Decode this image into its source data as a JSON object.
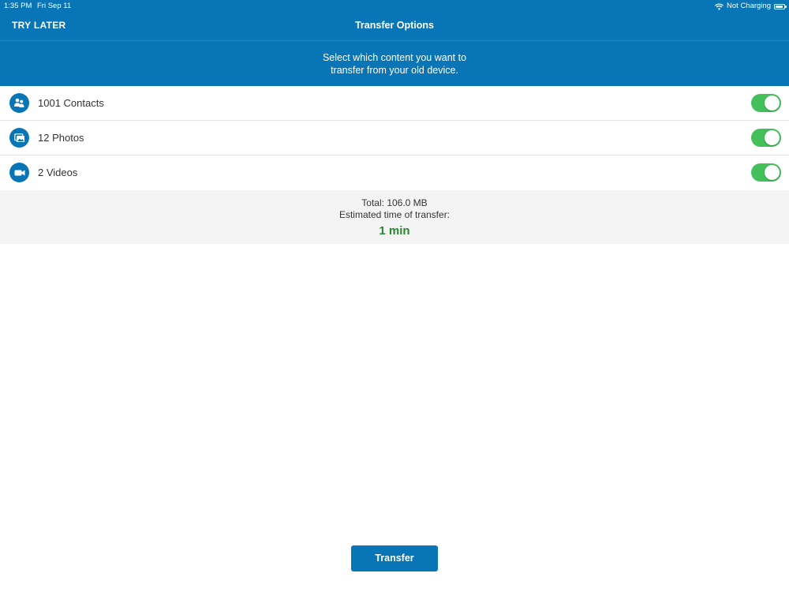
{
  "status_bar": {
    "time": "1:35 PM",
    "date": "Fri Sep 11",
    "charging_status": "Not Charging",
    "wifi_icon": "wifi-icon",
    "battery_icon": "battery-icon"
  },
  "nav": {
    "left_action": "TRY LATER",
    "title": "Transfer Options"
  },
  "instruction": {
    "line1": "Select which content you want to",
    "line2": "transfer from your old device."
  },
  "items": [
    {
      "label": "1001 Contacts",
      "icon": "contacts-icon",
      "enabled": true
    },
    {
      "label": "12 Photos",
      "icon": "photos-icon",
      "enabled": true
    },
    {
      "label": "2 Videos",
      "icon": "video-camera-icon",
      "enabled": true
    }
  ],
  "summary": {
    "total": "Total: 106.0 MB",
    "estimate_label": "Estimated time of transfer:",
    "estimate_value": "1 min"
  },
  "actions": {
    "transfer_label": "Transfer"
  },
  "colors": {
    "brand_blue": "#0875b7",
    "toggle_on": "#43c05a",
    "eta_green": "#27882f",
    "summary_bg": "#f4f4f4"
  }
}
